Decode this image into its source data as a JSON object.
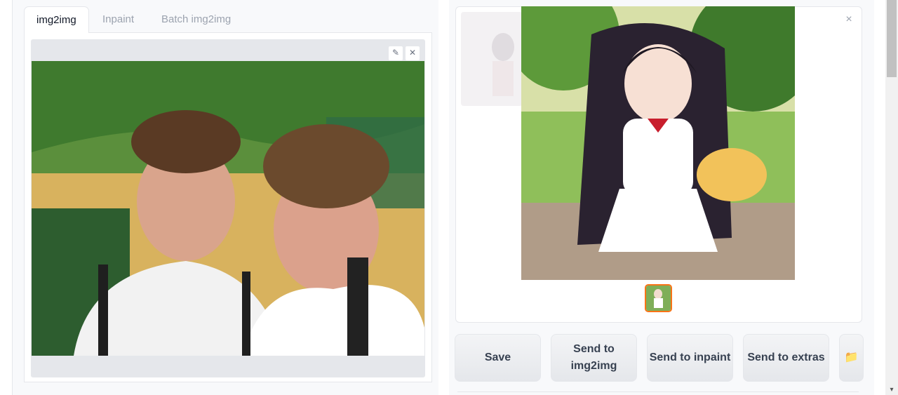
{
  "tabs": [
    {
      "label": "img2img",
      "active": true
    },
    {
      "label": "Inpaint",
      "active": false
    },
    {
      "label": "Batch img2img",
      "active": false
    }
  ],
  "input_image": {
    "icons": {
      "edit": "pencil-icon",
      "clear": "close-icon"
    }
  },
  "gallery": {
    "close_icon": "close-icon",
    "thumbnail_count": 1
  },
  "actions": {
    "save_label": "Save",
    "send_img2img_label": "Send to img2img",
    "send_inpaint_label": "Send to inpaint",
    "send_extras_label": "Send to extras",
    "open_folder_icon": "folder-icon"
  },
  "colors": {
    "accent": "#f97316",
    "panel_bg": "#f8f9fb",
    "border": "#e5e7eb"
  }
}
